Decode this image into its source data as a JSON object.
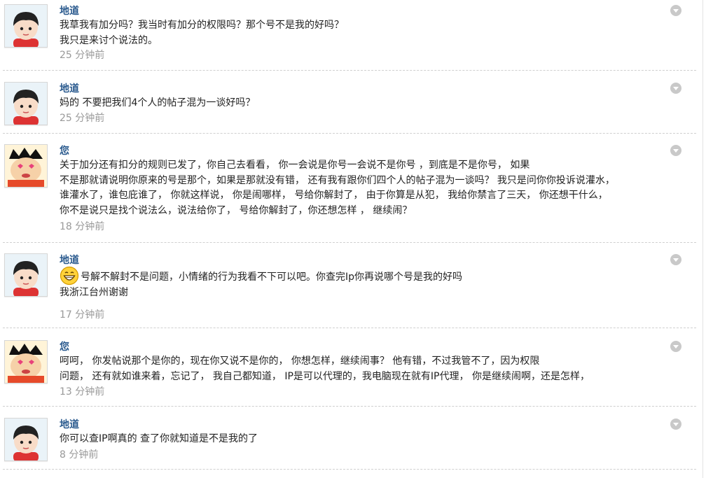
{
  "messages": [
    {
      "sender": "地道",
      "avatar": "boy",
      "lines": [
        "我草我有加分吗？我当时有加分的权限吗？那个号不是我的好吗？",
        "我只是来讨个说法的。"
      ],
      "time": "25 分钟前"
    },
    {
      "sender": "地道",
      "avatar": "boy",
      "lines": [
        "妈的 不要把我们4个人的帖子混为一谈好吗？"
      ],
      "time": "25 分钟前"
    },
    {
      "sender": "您",
      "avatar": "cartoon",
      "lines": [
        "关于加分还有扣分的规则已发了，你自己去看看，          你一会说是你号一会说不是你号      ，到底是不是你号，    如果",
        "不是那就请说明你原来的号是那个，如果是那就没有错，  还有我有跟你们四个人的帖子混为一谈吗？        我只是问你你投诉说灌水，",
        "谁灌水了，谁包庇谁了，      你就这样说，    你是闹哪样，      号给你解封了，    由于你算是从犯，    我给你禁言了三天，        你还想干什么，",
        "你不是说只是找个说法么，说法给你了，    号给你解封了，你还想怎样  ，    继续闹？"
      ],
      "time": "18 分钟前"
    },
    {
      "sender": "地道",
      "avatar": "boy",
      "emoji": "grin-emoji",
      "lines": [
        "号解不解封不是问题，小情绪的行为我看不下可以吧。你查完Ip你再说哪个号是我的好吗",
        "我浙江台州谢谢"
      ],
      "time": "17 分钟前"
    },
    {
      "sender": "您",
      "avatar": "cartoon",
      "lines": [
        "呵呵，    你发帖说那个是你的，现在你又说不是你的，      你想怎样，继续闹事？    他有错，不过我管不了，因为权限",
        "问题，    还有就如谁来着，忘记了，        我自己都知道，    IP是可以代理的，我电脑现在就有IP代理，        你是继续闹啊，还是怎样，"
      ],
      "time": "13 分钟前"
    },
    {
      "sender": "地道",
      "avatar": "boy",
      "lines": [
        "你可以查IP啊真的 查了你就知道是不是我的了"
      ],
      "time": "8 分钟前"
    }
  ]
}
